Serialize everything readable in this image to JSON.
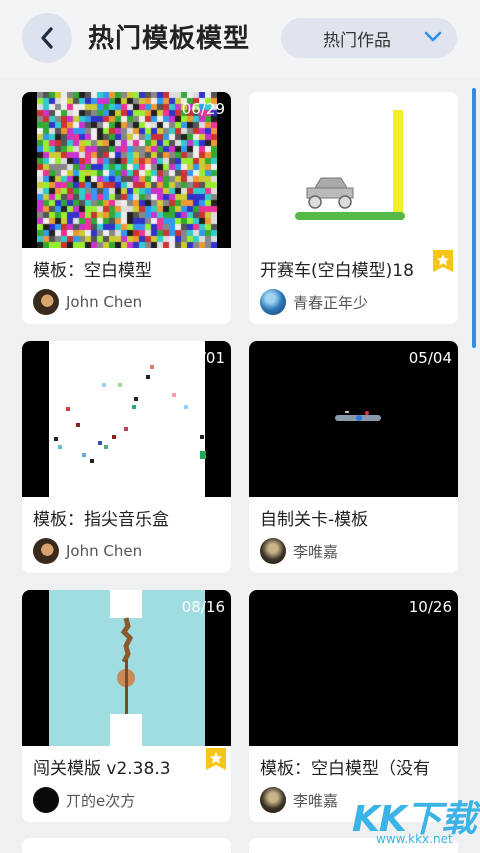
{
  "header": {
    "title": "热门模板模型",
    "dropdown_label": "热门作品"
  },
  "cards": [
    {
      "title": "模板：空白模型",
      "counter": "06/29",
      "author": "John Chen",
      "starred": false
    },
    {
      "title": "开赛车(空白模型)18",
      "counter": "",
      "author": "青春正年少",
      "starred": true
    },
    {
      "title": "模板：指尖音乐盒",
      "counter": "/01",
      "author": "John Chen",
      "starred": false
    },
    {
      "title": "自制关卡-模板",
      "counter": "05/04",
      "author": "李唯嘉",
      "starred": false
    },
    {
      "title": "闯关模版 v2.38.3",
      "counter": "08/16",
      "author": "丌的e次方",
      "starred": true
    },
    {
      "title": "模板：空白模型（没有",
      "counter": "10/26",
      "author": "李唯嘉",
      "starred": false
    }
  ],
  "watermark": {
    "text": "KK下载",
    "url": "www.kkx.net"
  },
  "colors": {
    "accent": "#2f8fe6",
    "star_badge": "#f5c518",
    "header_bg": "#f3f4f6",
    "page_bg": "#eef0f2"
  }
}
